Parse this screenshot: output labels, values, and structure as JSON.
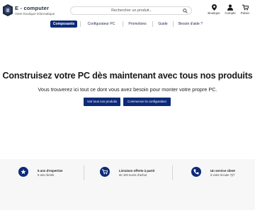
{
  "brand": {
    "title": "E - computer",
    "tagline": "Votre boutique informatique"
  },
  "search": {
    "placeholder": "Rechercher un produit..."
  },
  "header_icons": [
    {
      "icon": "location-pin-icon",
      "label": "Boutique"
    },
    {
      "icon": "user-icon",
      "label": "Compte"
    },
    {
      "icon": "cart-icon",
      "label": "Panier"
    }
  ],
  "nav": {
    "items": [
      {
        "label": "Composants",
        "active": true
      },
      {
        "label": "Configurateur PC"
      },
      {
        "label": "Promotions"
      },
      {
        "label": "Guide"
      },
      {
        "label": "Besoin d'aide ?"
      }
    ]
  },
  "hero": {
    "title": "Construisez votre PC dès maintenant avec tous nos produits",
    "subtitle": "Vous trouverez ici tout ce dont vous avez besoin pour monter votre propre PC.",
    "btn_products": "Voir tous nos produits",
    "btn_config": "Commencer la configuration"
  },
  "features": [
    {
      "icon": "star-icon",
      "title": "5 ans d'expertise",
      "sub": "5 ans clients"
    },
    {
      "icon": "cart-icon",
      "title": "Livraison offerte à partir",
      "sub": "de 100 euros d'achat"
    },
    {
      "icon": "phone-icon",
      "title": "Un service client",
      "sub": "à votre écoute 7j/7"
    }
  ],
  "colors": {
    "primary": "#0d2a7a",
    "band": "#f7f7f7"
  }
}
